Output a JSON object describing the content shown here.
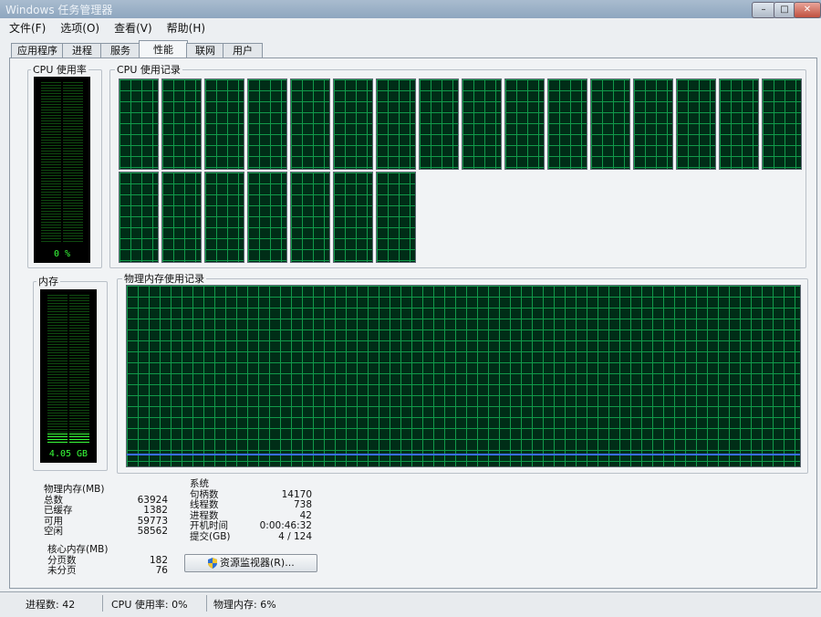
{
  "window": {
    "title": "Windows 任务管理器"
  },
  "menu": [
    "文件(F)",
    "选项(O)",
    "查看(V)",
    "帮助(H)"
  ],
  "tabs": [
    "应用程序",
    "进程",
    "服务",
    "性能",
    "联网",
    "用户"
  ],
  "active_tab": "性能",
  "cpu": {
    "usage_label": "CPU 使用率",
    "usage_value": "0 %",
    "usage_fraction": 0.0,
    "history_label": "CPU 使用记录",
    "core_count": 23
  },
  "memory": {
    "label": "内存",
    "value": "4.05 GB",
    "fraction": 0.06,
    "history_label": "物理内存使用记录"
  },
  "physical_memory": {
    "heading": "物理内存(MB)",
    "rows": [
      {
        "label": "总数",
        "value": "63924"
      },
      {
        "label": "已缓存",
        "value": "1382"
      },
      {
        "label": "可用",
        "value": "59773"
      },
      {
        "label": "空闲",
        "value": "58562"
      }
    ]
  },
  "kernel_memory": {
    "heading": "核心内存(MB)",
    "rows": [
      {
        "label": "分页数",
        "value": "182"
      },
      {
        "label": "未分页",
        "value": "76"
      }
    ]
  },
  "system": {
    "heading": "系统",
    "rows": [
      {
        "label": "句柄数",
        "value": "14170"
      },
      {
        "label": "线程数",
        "value": "738"
      },
      {
        "label": "进程数",
        "value": "42"
      },
      {
        "label": "开机时间",
        "value": "0:00:46:32"
      },
      {
        "label": "提交(GB)",
        "value": "4 / 124"
      }
    ]
  },
  "resource_monitor_button": "资源监视器(R)...",
  "statusbar": {
    "processes": "进程数: 42",
    "cpu": "CPU 使用率: 0%",
    "memory": "物理内存: 6%"
  },
  "colors": {
    "graph_bg": "#002d17",
    "grid": "#119a4a",
    "meter_on": "#39ff3a",
    "memory_line": "#3a6cff"
  }
}
